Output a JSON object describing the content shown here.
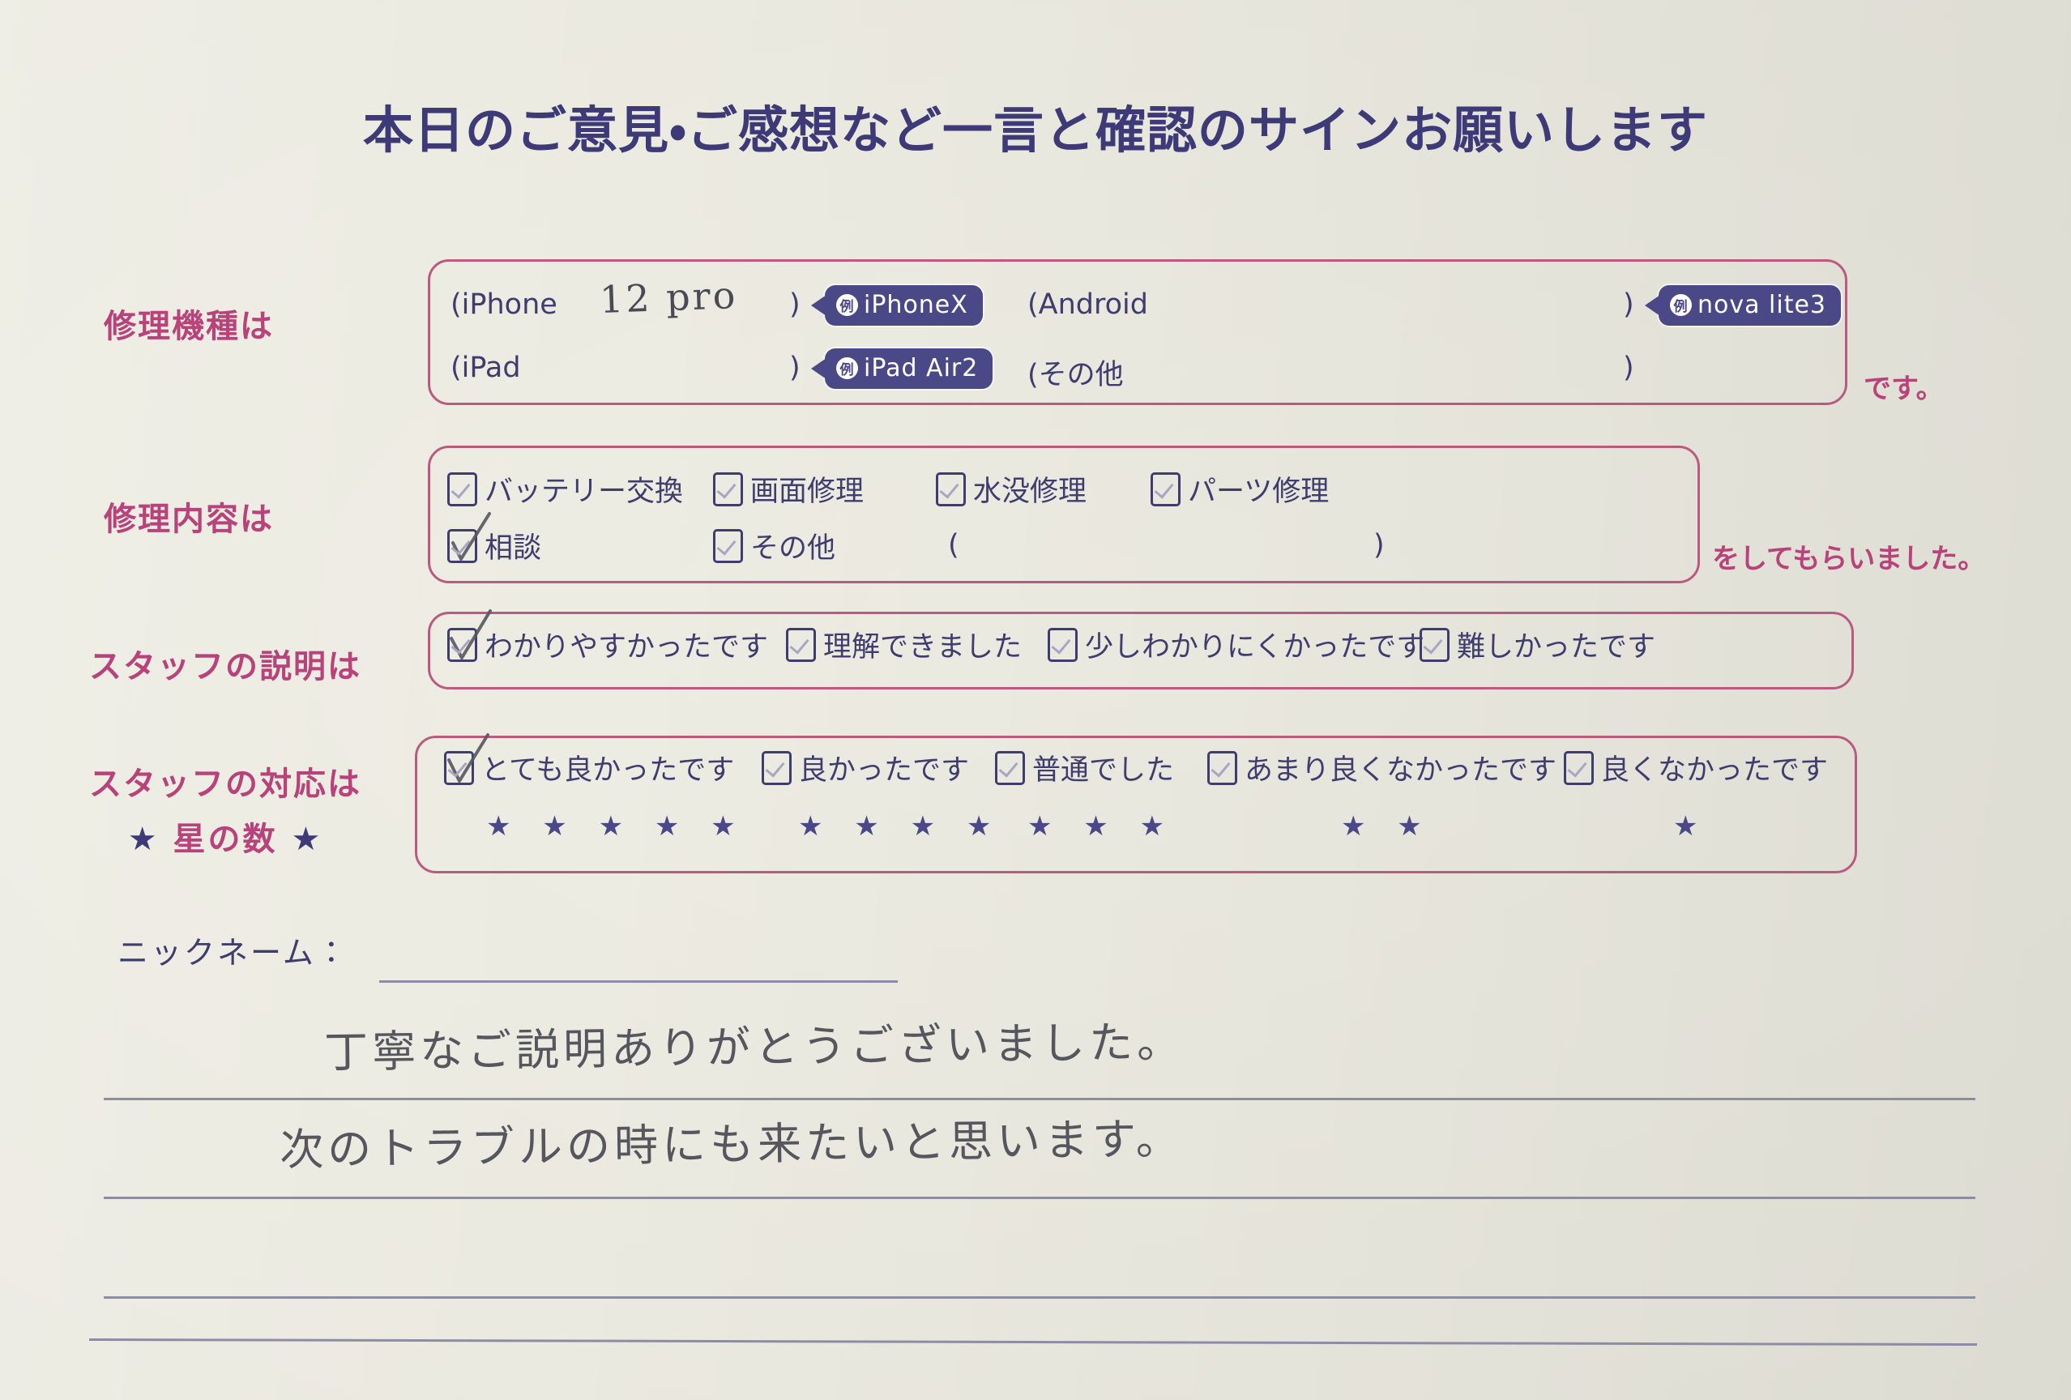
{
  "title": "本日のご意見・ご感想など一言と確認のサインお願いします",
  "device_row": {
    "label": "修理機種は",
    "tail": "です。",
    "entries": [
      {
        "name": "iPhone",
        "open": "(iPhone",
        "value": "12 pro",
        "close": ")",
        "badge": {
          "rei": "例",
          "text": "iPhoneX"
        }
      },
      {
        "name": "Android",
        "open": "(Android",
        "value": "",
        "close": ")",
        "badge": {
          "rei": "例",
          "text": "nova lite3"
        }
      },
      {
        "name": "iPad",
        "open": "(iPad",
        "value": "",
        "close": ")",
        "badge": {
          "rei": "例",
          "text": "iPad Air2"
        }
      },
      {
        "name": "その他",
        "open": "(その他",
        "value": "",
        "close": ")",
        "badge": null
      }
    ]
  },
  "repair_row": {
    "label": "修理内容は",
    "tail": "をしてもらいました。",
    "options": [
      {
        "label": "バッテリー交換",
        "checked": false
      },
      {
        "label": "画面修理",
        "checked": false
      },
      {
        "label": "水没修理",
        "checked": false
      },
      {
        "label": "パーツ修理",
        "checked": false
      },
      {
        "label": "相談",
        "checked": true
      },
      {
        "label": "その他",
        "checked": false
      }
    ],
    "other_open_paren": "(",
    "other_close_paren": ")"
  },
  "explanation_row": {
    "label": "スタッフの説明は",
    "options": [
      {
        "label": "わかりやすかったです",
        "checked": true
      },
      {
        "label": "理解できました",
        "checked": false
      },
      {
        "label": "少しわかりにくかったです",
        "checked": false
      },
      {
        "label": "難しかったです",
        "checked": false
      }
    ]
  },
  "response_row": {
    "label": "スタッフの対応は",
    "sub_label_left_star": "★",
    "sub_label": "星の数",
    "sub_label_right_star": "★",
    "options": [
      {
        "label": "とても良かったです",
        "checked": true,
        "stars": "★ ★ ★ ★ ★",
        "star_count": 5
      },
      {
        "label": "良かったです",
        "checked": false,
        "stars": "★ ★ ★ ★",
        "star_count": 4
      },
      {
        "label": "普通でした",
        "checked": false,
        "stars": "★ ★ ★",
        "star_count": 3
      },
      {
        "label": "あまり良くなかったです",
        "checked": false,
        "stars": "★ ★",
        "star_count": 2
      },
      {
        "label": "良くなかったです",
        "checked": false,
        "stars": "★",
        "star_count": 1
      }
    ]
  },
  "nickname": {
    "label": "ニックネーム：",
    "value": ""
  },
  "comment": {
    "line1": "丁寧なご説明ありがとうございました。",
    "line2": "次のトラブルの時にも来たいと思います。",
    "line3": "",
    "line4": ""
  },
  "colors": {
    "paper": "#eae9df",
    "navy": "#3f3c6e",
    "badge_navy": "#4b4887",
    "pink": "#b8437a",
    "box_pink": "#bb5a80",
    "pencil": "#4a4a54",
    "rule": "#8d8ca6"
  }
}
